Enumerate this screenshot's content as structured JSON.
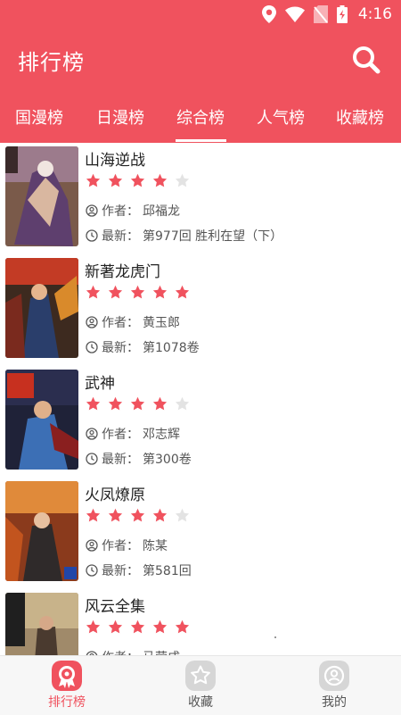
{
  "status_bar": {
    "time": "4:16"
  },
  "app_bar": {
    "title": "排行榜"
  },
  "tabs": [
    {
      "label": "国漫榜",
      "active": false
    },
    {
      "label": "日漫榜",
      "active": false
    },
    {
      "label": "综合榜",
      "active": true
    },
    {
      "label": "人气榜",
      "active": false
    },
    {
      "label": "收藏榜",
      "active": false
    }
  ],
  "meta_prefix": {
    "author": "作者：",
    "latest": "最新："
  },
  "comics": [
    {
      "title": "山海逆战",
      "rating": 4,
      "author": "邱福龙",
      "latest": "第977回 胜利在望（下）"
    },
    {
      "title": "新著龙虎门",
      "rating": 5,
      "author": "黄玉郎",
      "latest": "第1078卷"
    },
    {
      "title": "武神",
      "rating": 4,
      "author": "邓志辉",
      "latest": "第300卷"
    },
    {
      "title": "火凤燎原",
      "rating": 4,
      "author": "陈某",
      "latest": "第581回"
    },
    {
      "title": "风云全集",
      "rating": 5,
      "author": "马荣成",
      "latest": ""
    }
  ],
  "bottom_nav": [
    {
      "label": "排行榜",
      "active": true,
      "icon": "ranking-icon"
    },
    {
      "label": "收藏",
      "active": false,
      "icon": "favorite-star-icon"
    },
    {
      "label": "我的",
      "active": false,
      "icon": "profile-icon"
    }
  ],
  "colors": {
    "accent": "#f0525e",
    "star_on": "#f0525e",
    "star_off": "#e3e3e3"
  }
}
